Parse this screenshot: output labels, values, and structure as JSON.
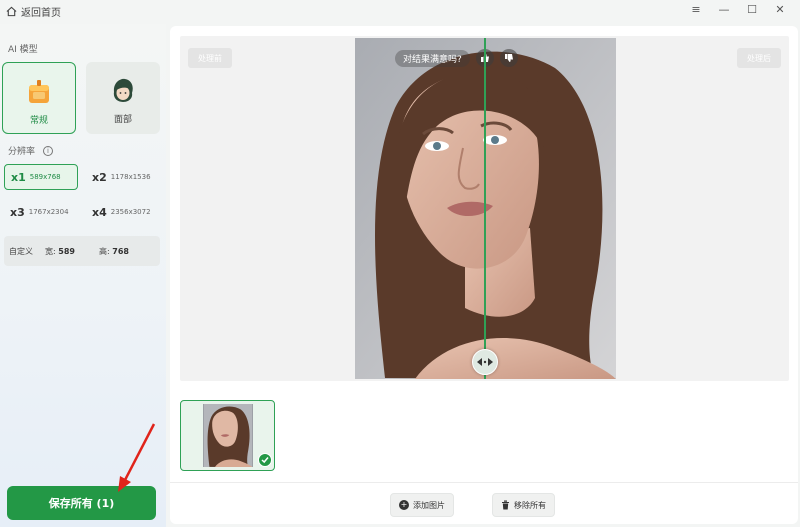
{
  "titlebar": {
    "back_label": "返回首页",
    "controls": {
      "menu": "≡",
      "minimize": "—",
      "maximize": "☐",
      "close": "✕"
    }
  },
  "sidebar": {
    "ai_model_title": "AI 模型",
    "models": [
      {
        "label": "常规",
        "icon": "cake-icon",
        "active": true
      },
      {
        "label": "面部",
        "icon": "face-icon",
        "active": false
      }
    ],
    "resolution_title": "分辨率",
    "resolutions": [
      {
        "scale": "x1",
        "dims": "589x768",
        "active": true
      },
      {
        "scale": "x2",
        "dims": "1178x1536",
        "active": false
      },
      {
        "scale": "x3",
        "dims": "1767x2304",
        "active": false
      },
      {
        "scale": "x4",
        "dims": "2356x3072",
        "active": false
      }
    ],
    "custom": {
      "label": "自定义",
      "width_label": "宽:",
      "width_value": "589",
      "height_label": "高:",
      "height_value": "768"
    },
    "save_button": "保存所有 (1)"
  },
  "preview": {
    "before_tag": "处理前",
    "after_tag": "处理后",
    "feedback_question": "对结果满意吗?",
    "feedback_icons": [
      "thumbs-up-icon",
      "thumbs-down-icon"
    ]
  },
  "actions": {
    "add_image": "添加图片",
    "remove_all": "移除所有"
  },
  "colors": {
    "accent": "#239846",
    "accent_light": "#e7f5ea",
    "annotation_arrow": "#e0241b"
  }
}
